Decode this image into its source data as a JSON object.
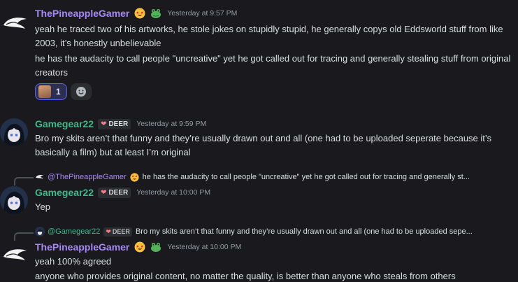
{
  "messages": [
    {
      "author": "ThePineappleGamer",
      "timestamp": "Yesterday at 9:57 PM",
      "lines": [
        "yeah he traced two of his artworks, he stole jokes on stupidly stupid, he generally copys old Eddsworld stuff from like 2003, it’s honestly unbelievable",
        "he has the audacity to call people \"uncreative\" yet he got called out for tracing and generally stealing stuff from original creators"
      ],
      "reactions": [
        {
          "emoji": "face-photo-emoji",
          "count": "1"
        }
      ]
    },
    {
      "author": "Gamegear22",
      "tag": "DEER",
      "timestamp": "Yesterday at 9:59 PM",
      "lines": [
        "Bro my skits aren’t that funny and they’re usually drawn out and all (one had to be uploaded seperate  because it’s basically a film) but at least I’m original"
      ]
    },
    {
      "reply_to": {
        "author": "@ThePineappleGamer",
        "text": "he has the audacity to call people \"uncreative\" yet he got called out for tracing and generally st..."
      },
      "author": "Gamegear22",
      "tag": "DEER",
      "timestamp": "Yesterday at 10:00 PM",
      "lines": [
        "Yep"
      ]
    },
    {
      "reply_to": {
        "author": "@Gamegear22",
        "tag": "DEER",
        "text": "Bro my skits aren’t that funny and they’re usually drawn out and all (one had to be uploaded sepe..."
      },
      "author": "ThePineappleGamer",
      "timestamp": "Yesterday at 10:00 PM",
      "lines": [
        "yeah 100% agreed",
        "anyone who provides original content, no matter the quality, is better than anyone who steals from others"
      ]
    }
  ],
  "colors": {
    "background": "#1a1a1e",
    "pineapple_name": "#a688f7",
    "gamegear_name": "#3fb88a",
    "timestamp": "#949ba4",
    "reaction_accent": "#5865f2"
  }
}
